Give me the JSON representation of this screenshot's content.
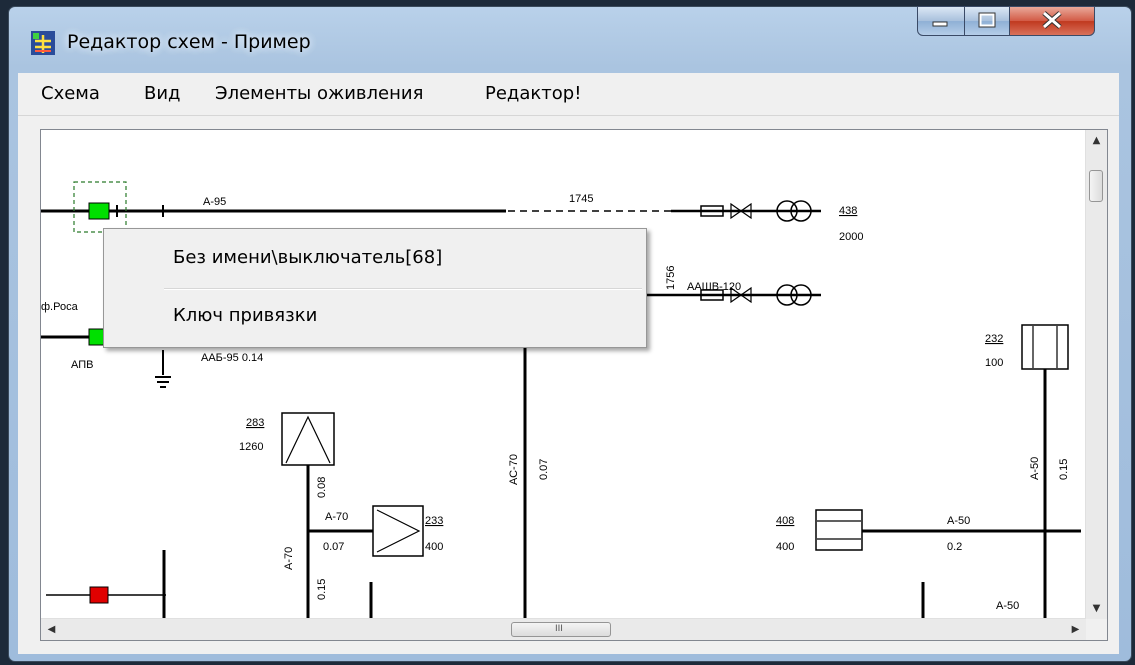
{
  "window": {
    "title": "Редактор схем - Пример",
    "controls": {
      "minimize": "minimize",
      "maximize": "maximize",
      "close": "close"
    }
  },
  "menu": {
    "items": [
      "Схема",
      "Вид",
      "Элементы оживления",
      "Редактор!"
    ]
  },
  "context_menu": {
    "items": [
      "Без имени\\выключатель[68]",
      "Ключ привязки"
    ]
  },
  "schema": {
    "labels": {
      "a95": "А-95",
      "n1745": "1745",
      "n438": "438",
      "n2000": "2000",
      "n1756": "1756",
      "aashv120": "ААШВ-120",
      "f_posa": "ф.Роса",
      "apv": "АПВ",
      "aab95": "ААБ-95  0.14",
      "n232": "232",
      "n100": "100",
      "n283": "283",
      "n1260": "1260",
      "n0_08": "0.08",
      "ac70": "АС-70",
      "n0_07v": "0.07",
      "a70h": "А-70",
      "n0_07h": "0.07",
      "n233": "233",
      "n400a": "400",
      "a70v": "А-70",
      "n0_15a": "0.15",
      "a50v": "А-50",
      "n0_15b": "0.15",
      "n408": "408",
      "n400b": "400",
      "a50h": "А-50",
      "n0_2": "0.2",
      "a50b": "А-50"
    },
    "colors": {
      "selected_switch": "#00e000",
      "red_switch": "#e00000"
    }
  },
  "scrollbars": {
    "horizontal_grip": "III"
  }
}
